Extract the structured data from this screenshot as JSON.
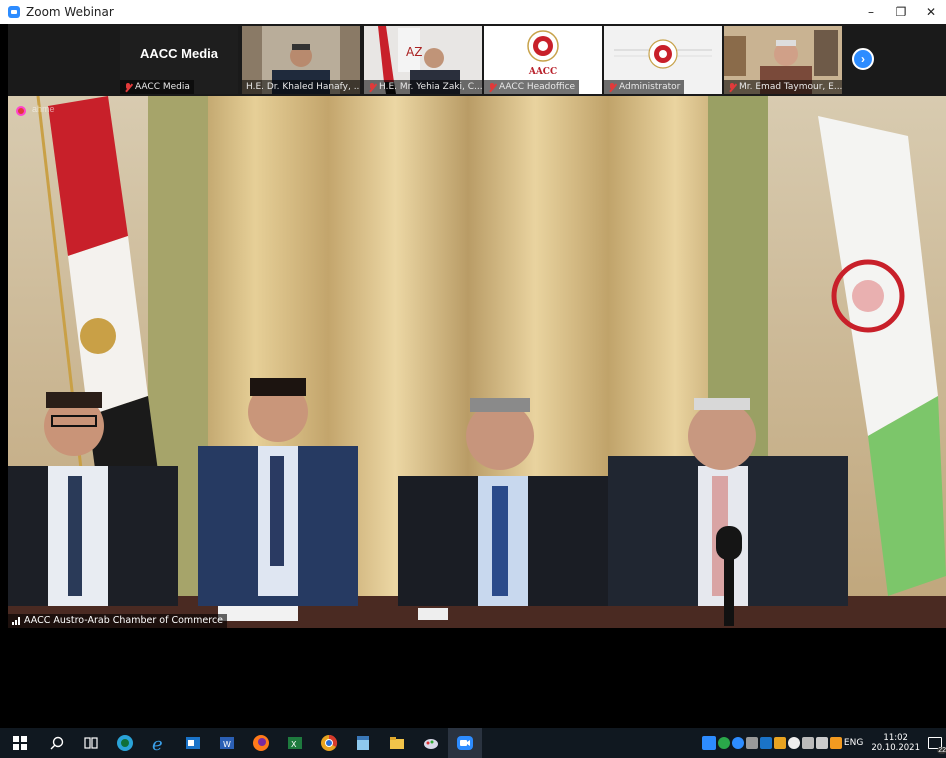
{
  "window": {
    "title": "Zoom Webinar",
    "minimize": "–",
    "restore": "❐",
    "close": "✕"
  },
  "thumbnails": [
    {
      "label": "AACC Media",
      "card_text": "AACC Media",
      "muted": true
    },
    {
      "label": "H.E. Dr. Khaled Hanafy, ...",
      "muted": false
    },
    {
      "label": "H.E. Mr. Yehia Zaki, C...",
      "muted": true
    },
    {
      "label": "AACC Headoffice",
      "muted": true
    },
    {
      "label": "Administrator",
      "muted": true
    },
    {
      "label": "Mr. Emad Taymour, E...",
      "muted": true
    }
  ],
  "thumbnail_logo_text": "AACC",
  "next_page_icon": "chevron-right",
  "main_video": {
    "speaker_label": "AACC Austro-Arab Chamber of Commerce",
    "top_left_text": "ahme"
  },
  "taskbar": {
    "icons": [
      "windows-start",
      "search",
      "task-view",
      "edge",
      "internet-explorer",
      "outlook",
      "word",
      "firefox",
      "excel",
      "chrome",
      "notepad",
      "file-explorer",
      "paint",
      "zoom"
    ],
    "language": "ENG",
    "time": "11:02",
    "date": "20.10.2021",
    "notifications": "22"
  },
  "colors": {
    "accent": "#2d8cff",
    "muted_red": "#e03a3a",
    "taskbar": "#101820"
  }
}
